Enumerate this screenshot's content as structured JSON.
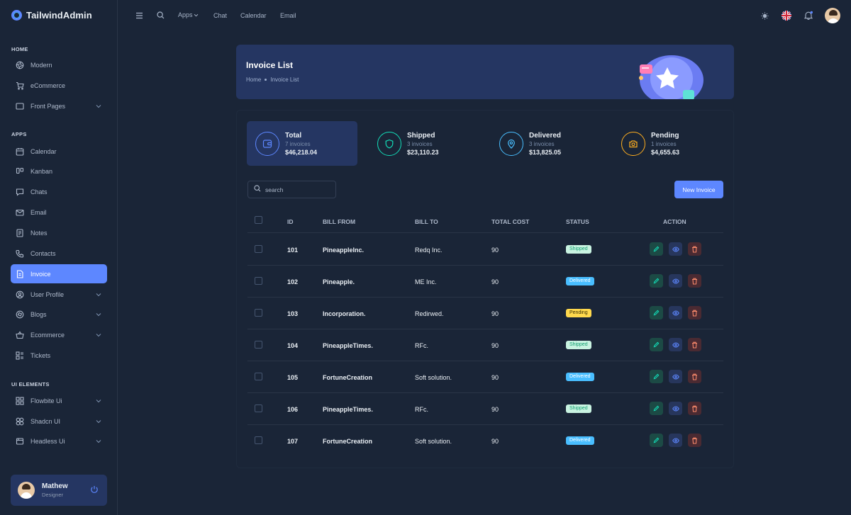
{
  "app": {
    "title": "TailwindAdmin"
  },
  "sidebar": {
    "sections": [
      {
        "label": "HOME",
        "items": [
          {
            "label": "Modern",
            "icon": "aperture-icon"
          },
          {
            "label": "eCommerce",
            "icon": "cart-icon"
          },
          {
            "label": "Front Pages",
            "icon": "window-icon",
            "chevron": true
          }
        ]
      },
      {
        "label": "APPS",
        "items": [
          {
            "label": "Calendar",
            "icon": "calendar-icon"
          },
          {
            "label": "Kanban",
            "icon": "kanban-icon"
          },
          {
            "label": "Chats",
            "icon": "chat-icon"
          },
          {
            "label": "Email",
            "icon": "mail-icon"
          },
          {
            "label": "Notes",
            "icon": "notes-icon"
          },
          {
            "label": "Contacts",
            "icon": "phone-icon"
          },
          {
            "label": "Invoice",
            "icon": "invoice-icon",
            "active": true
          },
          {
            "label": "User Profile",
            "icon": "user-icon",
            "chevron": true
          },
          {
            "label": "Blogs",
            "icon": "blog-icon",
            "chevron": true
          },
          {
            "label": "Ecommerce",
            "icon": "basket-icon",
            "chevron": true
          },
          {
            "label": "Tickets",
            "icon": "ticket-icon"
          }
        ]
      },
      {
        "label": "UI ELEMENTS",
        "items": [
          {
            "label": "Flowbite Ui",
            "icon": "grid-icon",
            "chevron": true
          },
          {
            "label": "Shadcn UI",
            "icon": "shapes-icon",
            "chevron": true
          },
          {
            "label": "Headless Ui",
            "icon": "layers-icon",
            "chevron": true
          }
        ]
      }
    ],
    "user": {
      "name": "Mathew",
      "role": "Designer"
    }
  },
  "topbar": {
    "links": [
      "Apps",
      "Chat",
      "Calendar",
      "Email"
    ]
  },
  "banner": {
    "title": "Invoice List",
    "breadcrumb": [
      "Home",
      "Invoice List"
    ]
  },
  "stats": [
    {
      "title": "Total",
      "count": "7 invoices",
      "amount": "$46,218.04",
      "color": "#5d87ff",
      "icon": "wallet-icon",
      "active": true
    },
    {
      "title": "Shipped",
      "count": "3 invoices",
      "amount": "$23,110.23",
      "color": "#13deb9",
      "icon": "shield-icon",
      "active": false
    },
    {
      "title": "Delivered",
      "count": "3 invoices",
      "amount": "$13,825.05",
      "color": "#49beff",
      "icon": "pin-icon",
      "active": false
    },
    {
      "title": "Pending",
      "count": "1 invoices",
      "amount": "$4,655.63",
      "color": "#ffae1f",
      "icon": "camera-icon",
      "active": false
    }
  ],
  "search": {
    "placeholder": "search"
  },
  "new_invoice_label": "New Invoice",
  "table": {
    "headers": [
      "ID",
      "BILL FROM",
      "BILL TO",
      "TOTAL COST",
      "STATUS",
      "ACTION"
    ],
    "rows": [
      {
        "id": "101",
        "from": "PineappleInc.",
        "to": "Redq Inc.",
        "cost": "90",
        "status": "Shipped"
      },
      {
        "id": "102",
        "from": "Pineapple.",
        "to": "ME Inc.",
        "cost": "90",
        "status": "Delivered"
      },
      {
        "id": "103",
        "from": "Incorporation.",
        "to": "Redirwed.",
        "cost": "90",
        "status": "Pending"
      },
      {
        "id": "104",
        "from": "PineappleTimes.",
        "to": "RFc.",
        "cost": "90",
        "status": "Shipped"
      },
      {
        "id": "105",
        "from": "FortuneCreation",
        "to": "Soft solution.",
        "cost": "90",
        "status": "Delivered"
      },
      {
        "id": "106",
        "from": "PineappleTimes.",
        "to": "RFc.",
        "cost": "90",
        "status": "Shipped"
      },
      {
        "id": "107",
        "from": "FortuneCreation",
        "to": "Soft solution.",
        "cost": "90",
        "status": "Delivered"
      }
    ]
  },
  "colors": {
    "primary": "#5d87ff",
    "success": "#13deb9",
    "info": "#49beff",
    "warning": "#ffae1f",
    "danger": "#fa896b"
  }
}
